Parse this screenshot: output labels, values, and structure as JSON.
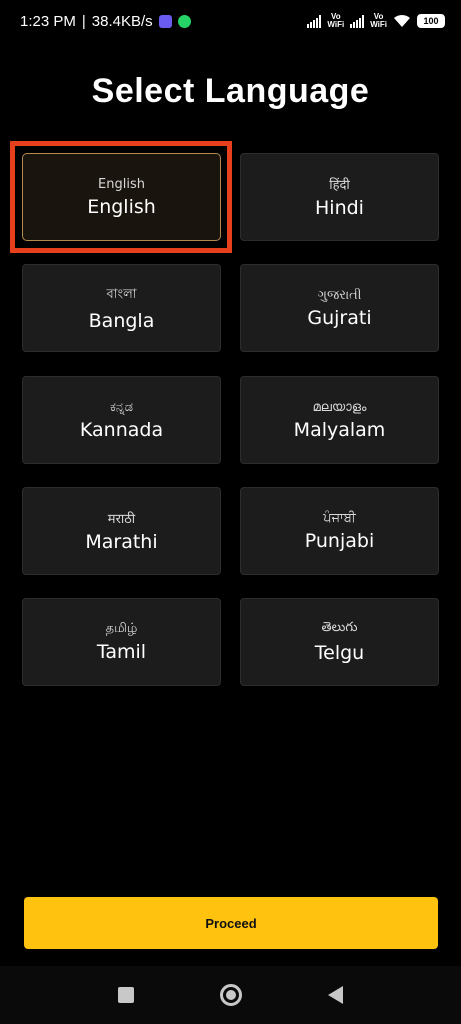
{
  "status_bar": {
    "time": "1:23 PM",
    "separator": "|",
    "net_speed": "38.4KB/s",
    "vowifi_1_top": "Vo",
    "vowifi_1_bottom": "WiFi",
    "vowifi_2_top": "Vo",
    "vowifi_2_bottom": "WiFi",
    "battery": "100"
  },
  "title": "Select Language",
  "languages": [
    {
      "native": "English",
      "english": "English",
      "selected": true
    },
    {
      "native": "हिंदी",
      "english": "Hindi"
    },
    {
      "native": "বাংলা",
      "english": "Bangla"
    },
    {
      "native": "ગુજરાતી",
      "english": "Gujrati"
    },
    {
      "native": "ಕನ್ನಡ",
      "english": "Kannada"
    },
    {
      "native": "മലയാളം",
      "english": "Malyalam"
    },
    {
      "native": "मराठी",
      "english": "Marathi"
    },
    {
      "native": "ਪੰਜਾਬੀ",
      "english": "Punjabi"
    },
    {
      "native": "தமிழ்",
      "english": "Tamil"
    },
    {
      "native": "తెలుగు",
      "english": "Telgu"
    }
  ],
  "proceed_label": "Proceed",
  "colors": {
    "accent": "#ffc20e",
    "highlight": "#e8401c",
    "card_bg": "#1c1c1c",
    "background": "#000000"
  }
}
